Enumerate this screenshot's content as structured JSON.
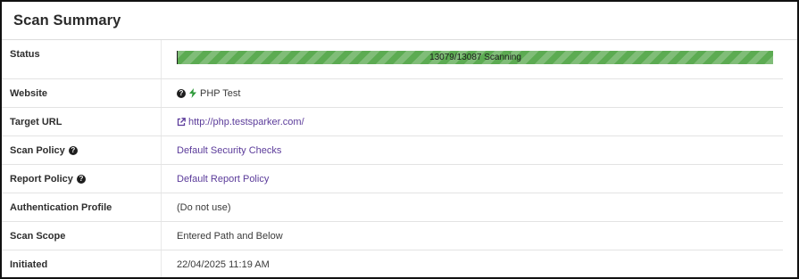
{
  "panel": {
    "title": "Scan Summary"
  },
  "status": {
    "label": "Status",
    "progress_text": "13079/13087 Scanning",
    "progress_fraction": 0.9994,
    "bar_color": "#5cab52"
  },
  "website": {
    "label": "Website",
    "value": "PHP Test",
    "icons": [
      "question-circle-icon",
      "bolt-icon"
    ]
  },
  "target_url": {
    "label": "Target URL",
    "value": "http://php.testsparker.com/",
    "icon": "external-link-icon"
  },
  "scan_policy": {
    "label": "Scan Policy",
    "value": "Default Security Checks",
    "icon": "question-circle-icon"
  },
  "report_policy": {
    "label": "Report Policy",
    "value": "Default Report Policy",
    "icon": "question-circle-icon"
  },
  "auth_profile": {
    "label": "Authentication Profile",
    "value": "(Do not use)"
  },
  "scan_scope": {
    "label": "Scan Scope",
    "value": "Entered Path and Below"
  },
  "initiated": {
    "label": "Initiated",
    "value": "22/04/2025 11:19 AM"
  },
  "colors": {
    "link": "#5b3b9a",
    "bolt": "#2e9a3a",
    "border": "#111111"
  }
}
